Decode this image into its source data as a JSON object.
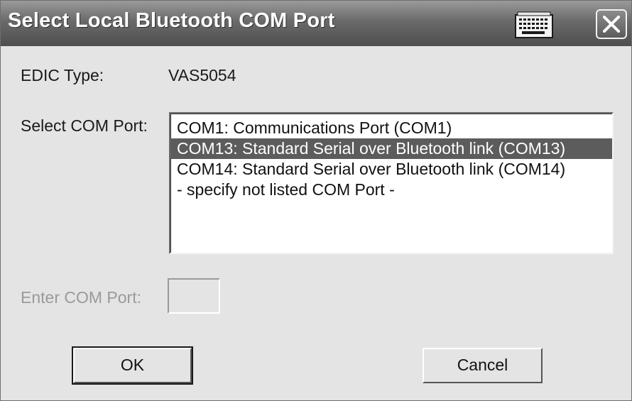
{
  "window": {
    "title": "Select Local Bluetooth COM Port",
    "icons": [
      "keyboard-icon",
      "close-icon"
    ]
  },
  "edic": {
    "label": "EDIC Type:",
    "value": "VAS5054"
  },
  "com_select": {
    "label": "Select COM Port:",
    "options": [
      "COM1: Communications Port (COM1)",
      "COM13: Standard Serial over Bluetooth link (COM13)",
      "COM14: Standard Serial over Bluetooth link (COM14)",
      "- specify not listed COM Port -"
    ],
    "selected_index": 1
  },
  "enter_port": {
    "label": "Enter COM Port:",
    "value": "",
    "disabled": true
  },
  "buttons": {
    "ok": "OK",
    "cancel": "Cancel"
  },
  "colors": {
    "titlebar": "#5e5e5e",
    "selection": "#5c5c5c",
    "dialog_bg": "#e4e4e4"
  }
}
